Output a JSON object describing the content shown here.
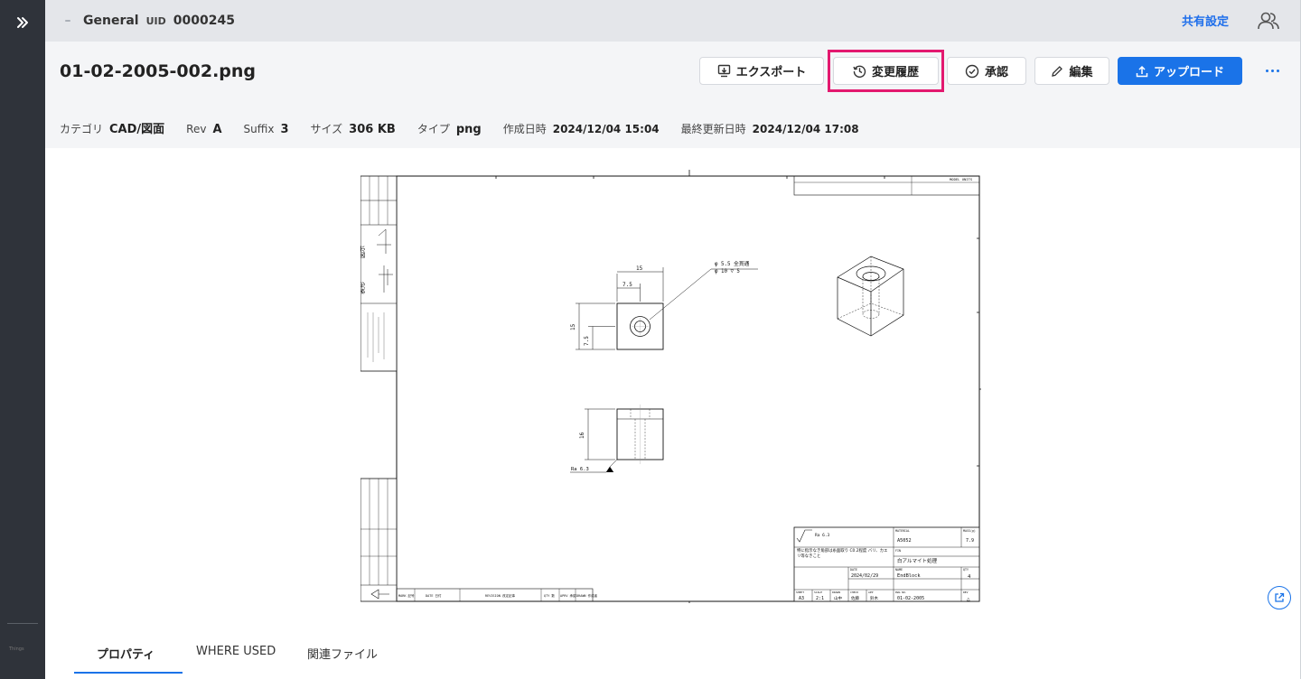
{
  "rail": {
    "expand_icon": "double-chevron-right-icon",
    "footer_text": "Things"
  },
  "topbar": {
    "workspace": "General",
    "uid_label": "UID",
    "uid_value": "0000245",
    "share_label": "共有設定",
    "users_icon": "users-icon"
  },
  "file": {
    "title": "01-02-2005-002.png"
  },
  "toolbar": {
    "export_label": "エクスポート",
    "history_label": "変更履歴",
    "approve_label": "承認",
    "edit_label": "編集",
    "upload_label": "アップロード",
    "more_icon": "more-horizontal-icon",
    "accent": "#1a73e8",
    "highlight_color": "#e3196f"
  },
  "meta": {
    "category_label": "カテゴリ",
    "category_value": "CAD/図面",
    "rev_label": "Rev",
    "rev_value": "A",
    "suffix_label": "Suffix",
    "suffix_value": "3",
    "size_label": "サイズ",
    "size_value": "306 KB",
    "type_label": "タイプ",
    "type_value": "png",
    "created_label": "作成日時",
    "created_value": "2024/12/04 15:04",
    "updated_label": "最終更新日時",
    "updated_value": "2024/12/04 17:08"
  },
  "drawing": {
    "dim_15_top": "15",
    "dim_7_5_top": "7.5",
    "dim_15_left": "15",
    "dim_7_5_left": "7.5",
    "hole_note_1": "φ 5.5 全貫通",
    "hole_note_2": "φ 10 ▽ 5",
    "dim_16": "16",
    "roughness": "Ra 6.3",
    "title_block": {
      "roughness_symbol": "Ra 6.3",
      "material_label": "MATERIAL",
      "material_value": "A5052",
      "mass_label": "MASS(g)",
      "mass_value": "7.9",
      "note": "特に指示なき角部は糸面取り C0.2程度 バリ、カエリ等なきこと",
      "finish_label": "FIN",
      "finish_value": "白アルマイト処理",
      "date_label": "DATE",
      "date_value": "2024/02/29",
      "name_label": "NAME",
      "name_value": "EndBlock",
      "qty_label": "QTY",
      "qty_value": "4",
      "sheet_label": "SHEET",
      "sheet_value": "A3",
      "scale_label": "SCALE",
      "scale_value": "2:1",
      "drawn_label": "DRAWN",
      "drawn_value": "山中",
      "check_label": "CHECK",
      "check_value": "佐藤",
      "appr_label": "APP",
      "appr_value": "鈴木",
      "dwg_label": "DWG NO.",
      "dwg_value": "01-02-2005",
      "rev_label": "REV",
      "rev_value": "△",
      "model_units": "MODEL UNITS"
    },
    "revision_header": {
      "mark": "MARK 記号",
      "date": "DATE 日付",
      "revision": "REVISION 改定記事",
      "qty": "QTY 数",
      "appr": "APRV 承認",
      "drawn": "DRAWN 作成者"
    },
    "side_labels": {
      "top": "図示",
      "mid": "表形"
    }
  },
  "viewer": {
    "open_external_icon": "open-external-icon"
  },
  "tabs": [
    {
      "label": "プロパティ"
    },
    {
      "label": "WHERE USED"
    },
    {
      "label": "関連ファイル"
    }
  ]
}
